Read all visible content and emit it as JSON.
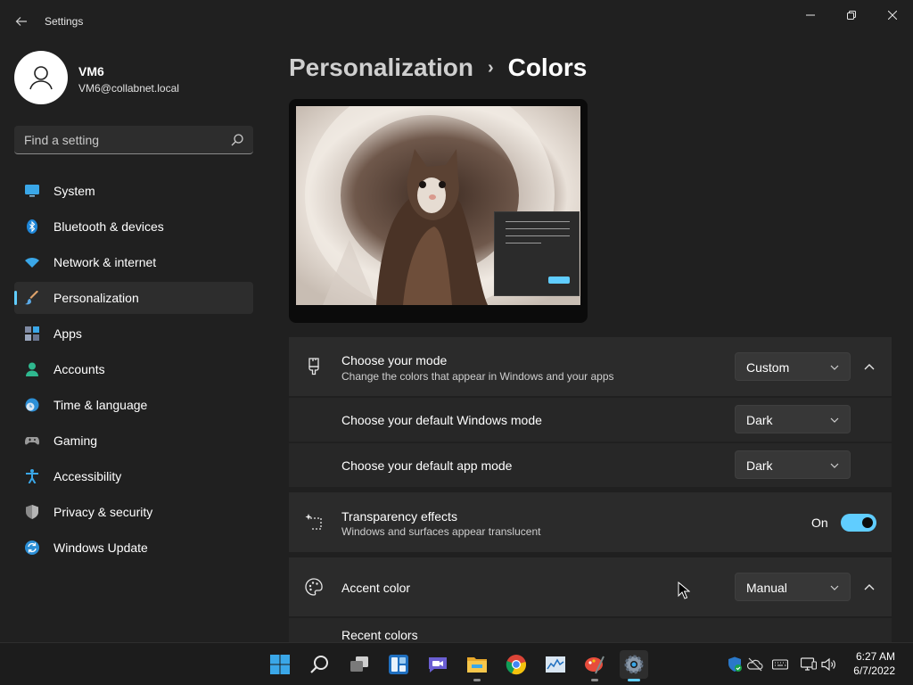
{
  "window": {
    "app_title": "Settings",
    "back_icon": "arrow-left-icon",
    "minimize_icon": "minimize-icon",
    "maximize_icon": "restore-icon",
    "close_icon": "close-icon"
  },
  "profile": {
    "name": "VM6",
    "email": "VM6@collabnet.local"
  },
  "search": {
    "placeholder": "Find a setting",
    "value": ""
  },
  "sidebar": {
    "items": [
      {
        "label": "System",
        "icon": "monitor-icon",
        "active": false
      },
      {
        "label": "Bluetooth & devices",
        "icon": "bluetooth-icon",
        "active": false
      },
      {
        "label": "Network & internet",
        "icon": "wifi-icon",
        "active": false
      },
      {
        "label": "Personalization",
        "icon": "brush-icon",
        "active": true
      },
      {
        "label": "Apps",
        "icon": "apps-icon",
        "active": false
      },
      {
        "label": "Accounts",
        "icon": "person-icon",
        "active": false
      },
      {
        "label": "Time & language",
        "icon": "globe-clock-icon",
        "active": false
      },
      {
        "label": "Gaming",
        "icon": "gamepad-icon",
        "active": false
      },
      {
        "label": "Accessibility",
        "icon": "accessibility-icon",
        "active": false
      },
      {
        "label": "Privacy & security",
        "icon": "shield-icon",
        "active": false
      },
      {
        "label": "Windows Update",
        "icon": "sync-icon",
        "active": false
      }
    ]
  },
  "breadcrumb": {
    "parent": "Personalization",
    "separator": "›",
    "current": "Colors"
  },
  "settings": {
    "mode": {
      "title": "Choose your mode",
      "description": "Change the colors that appear in Windows and your apps",
      "value": "Custom"
    },
    "windows_mode": {
      "title": "Choose your default Windows mode",
      "value": "Dark"
    },
    "app_mode": {
      "title": "Choose your default app mode",
      "value": "Dark"
    },
    "transparency": {
      "title": "Transparency effects",
      "description": "Windows and surfaces appear translucent",
      "state_label": "On",
      "on": true
    },
    "accent": {
      "title": "Accent color",
      "value": "Manual"
    },
    "recent_colors": {
      "title": "Recent colors"
    }
  },
  "taskbar": {
    "apps": [
      {
        "name": "start",
        "icon": "windows-start-icon"
      },
      {
        "name": "search",
        "icon": "search-icon"
      },
      {
        "name": "task-view",
        "icon": "task-view-icon"
      },
      {
        "name": "widgets",
        "icon": "widgets-icon"
      },
      {
        "name": "chat",
        "icon": "chat-icon"
      },
      {
        "name": "file-explorer",
        "icon": "folder-icon"
      },
      {
        "name": "chrome",
        "icon": "chrome-icon"
      },
      {
        "name": "performance-monitor",
        "icon": "chart-icon"
      },
      {
        "name": "paint",
        "icon": "paint-icon"
      },
      {
        "name": "settings",
        "icon": "gear-icon"
      }
    ],
    "clock_time": "6:27 AM",
    "clock_date": "6/7/2022"
  },
  "colors": {
    "accent": "#60cdff",
    "background": "#202020",
    "card": "#2b2b2b"
  }
}
